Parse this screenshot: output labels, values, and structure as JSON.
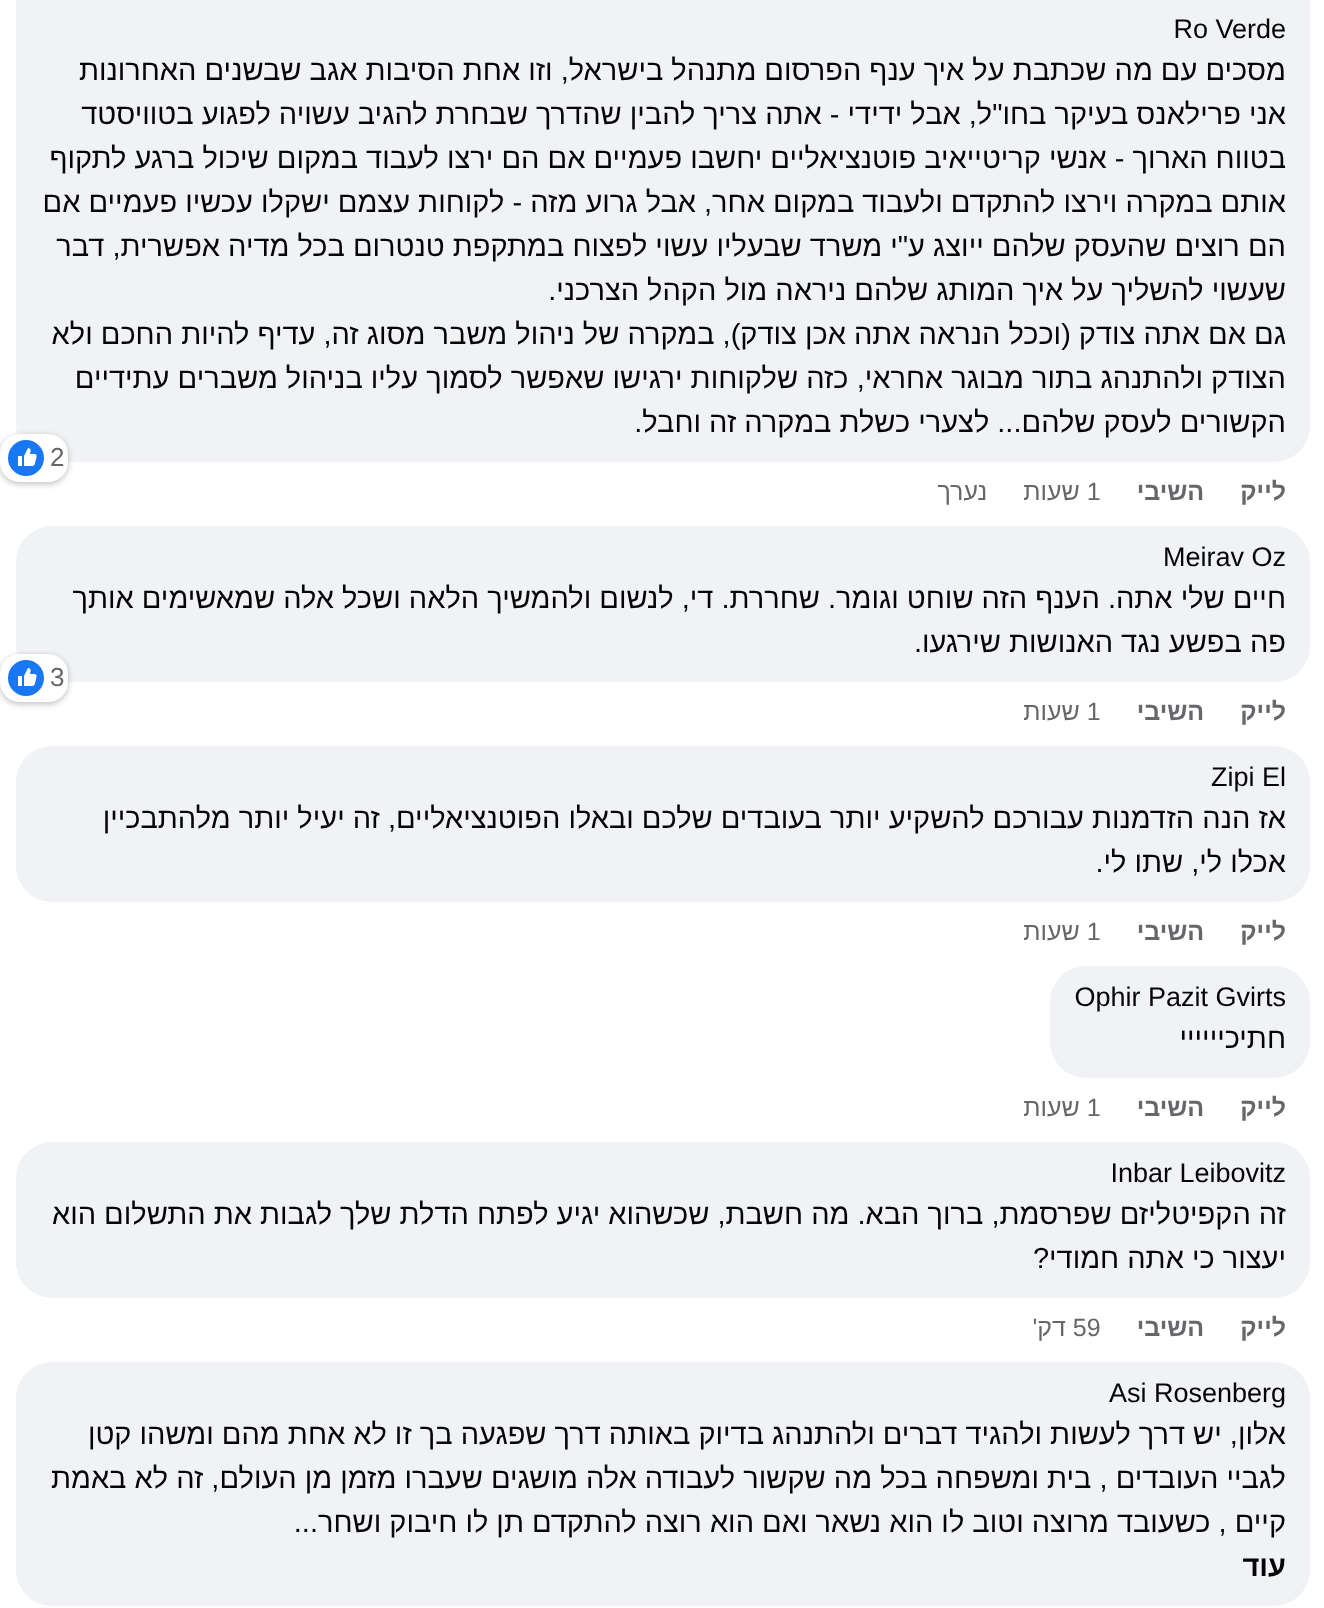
{
  "comments": [
    {
      "author": "Ro Verde",
      "paragraphs": [
        "מסכים עם מה שכתבת על איך ענף הפרסום מתנהל בישראל, וזו אחת הסיבות אגב שבשנים האחרונות אני פרילאנס בעיקר בחו\"ל, אבל ידידי - אתה צריך להבין שהדרך שבחרת להגיב עשויה לפגוע בטוויסטד בטווח הארוך - אנשי קריטייאיב פוטנציאליים יחשבו פעמיים אם הם ירצו לעבוד במקום שיכול ברגע לתקוף אותם במקרה וירצו להתקדם ולעבוד במקום אחר, אבל גרוע מזה - לקוחות עצמם ישקלו עכשיו פעמיים אם הם רוצים שהעסק שלהם ייוצג ע\"י משרד שבעליו עשוי לפצוח במתקפת טנטרום בכל מדיה אפשרית, דבר שעשוי להשליך על איך המותג שלהם ניראה מול הקהל הצרכני.",
        "גם אם אתה צודק (וככל הנראה אתה אכן צודק), במקרה של ניהול משבר מסוג זה, עדיף להיות החכם ולא הצודק ולהתנהג בתור מבוגר אחראי, כזה שלקוחות ירגישו שאפשר לסמוך עליו בניהול משברים עתידיים הקשורים לעסק שלהם... לצערי כשלת במקרה זה וחבל."
      ],
      "reactions": "2",
      "like": "לייק",
      "reply": "השיבי",
      "time": "1 שעות",
      "edited": "נערך"
    },
    {
      "author": "Meirav Oz",
      "paragraphs": [
        "חיים שלי אתה. הענף הזה שוחט וגומר. שחררת. די, לנשום ולהמשיך הלאה ושכל אלה שמאשימים אותך פה בפשע נגד האנושות שירגעו."
      ],
      "reactions": "3",
      "like": "לייק",
      "reply": "השיבי",
      "time": "1 שעות"
    },
    {
      "author": "Zipi El",
      "paragraphs": [
        "אז הנה הזדמנות עבורכם להשקיע יותר בעובדים שלכם ובאלו הפוטנציאליים, זה יעיל יותר מלהתבכיין אכלו לי, שתו לי."
      ],
      "like": "לייק",
      "reply": "השיבי",
      "time": "1 שעות"
    },
    {
      "author": "Ophir Pazit Gvirts",
      "paragraphs": [
        "חתיכיייייי"
      ],
      "like": "לייק",
      "reply": "השיבי",
      "time": "1 שעות"
    },
    {
      "author": "Inbar Leibovitz",
      "paragraphs": [
        "זה הקפיטליזם שפרסמת, ברוך הבא. מה חשבת, שכשהוא יגיע לפתח הדלת שלך לגבות את התשלום הוא יעצור כי אתה חמודי?"
      ],
      "like": "לייק",
      "reply": "השיבי",
      "time": "59 דק'"
    },
    {
      "author": "Asi Rosenberg",
      "paragraphs": [
        "אלון, יש דרך לעשות ולהגיד דברים ולהתנהג בדיוק באותה דרך שפגעה בך זו לא אחת מהם ומשהו קטן לגביי העובדים , בית ומשפחה בכל מה שקשור לעבודה אלה מושגים שעברו מזמן מן העולם, זה לא באמת קיים , כשעובד מרוצה וטוב לו הוא נשאר ואם הוא רוצה להתקדם תן לו חיבוק ושחר..."
      ],
      "more": "עוד"
    }
  ]
}
